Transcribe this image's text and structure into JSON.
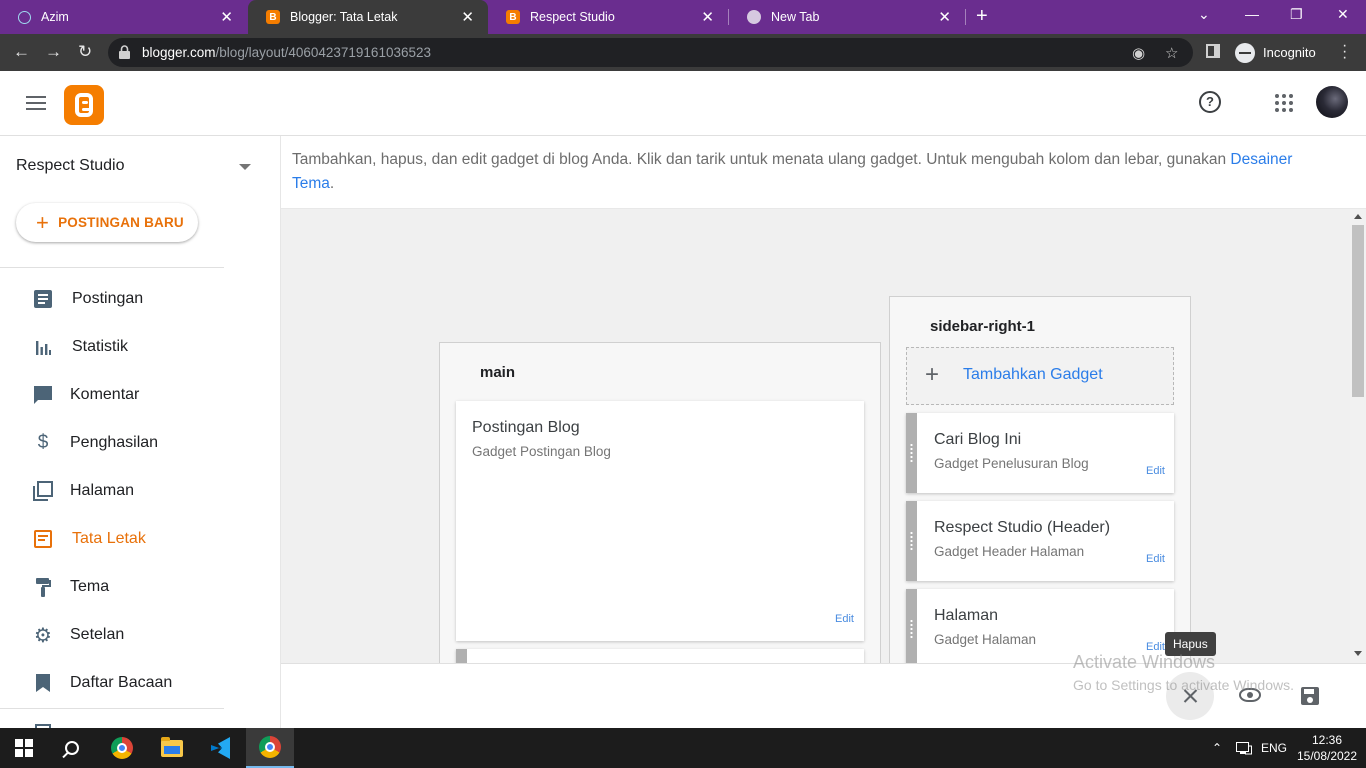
{
  "browser": {
    "tabs": [
      {
        "title": "Azim",
        "active": false
      },
      {
        "title": "Blogger: Tata Letak",
        "active": true
      },
      {
        "title": "Respect Studio",
        "active": false
      },
      {
        "title": "New Tab",
        "active": false
      }
    ],
    "close_glyph": "✕",
    "new_tab_glyph": "+",
    "url_host": "blogger.com",
    "url_path": "/blog/layout/4060423719161036523",
    "profile_label": "Incognito"
  },
  "header": {
    "help_glyph": "?"
  },
  "sidebar": {
    "blog_name": "Respect Studio",
    "new_post_plus": "+",
    "new_post_label": "POSTINGAN BARU",
    "items": [
      {
        "label": "Postingan",
        "icon": "posts-icon"
      },
      {
        "label": "Statistik",
        "icon": "stats-icon"
      },
      {
        "label": "Komentar",
        "icon": "comments-icon"
      },
      {
        "label": "Penghasilan",
        "icon": "earnings-icon"
      },
      {
        "label": "Halaman",
        "icon": "pages-icon"
      },
      {
        "label": "Tata Letak",
        "icon": "layout-icon",
        "active": true
      },
      {
        "label": "Tema",
        "icon": "theme-icon"
      },
      {
        "label": "Setelan",
        "icon": "settings-icon"
      },
      {
        "label": "Daftar Bacaan",
        "icon": "reading-list-icon"
      }
    ],
    "dollar_glyph": "$"
  },
  "main": {
    "info_text": "Tambahkan, hapus, dan edit gadget di blog Anda. Klik dan tarik untuk menata ulang gadget. Untuk mengubah kolom dan lebar, gunakan ",
    "info_link": "Desainer Tema",
    "info_end": ".",
    "sections": {
      "main": {
        "title": "main",
        "gadgets": [
          {
            "title": "Postingan Blog",
            "subtitle": "Gadget Postingan Blog",
            "edit": "Edit"
          }
        ]
      },
      "sidebar_right": {
        "title": "sidebar-right-1",
        "add_plus": "+",
        "add_label": "Tambahkan Gadget",
        "gadgets": [
          {
            "title": "Cari Blog Ini",
            "subtitle": "Gadget Penelusuran Blog",
            "edit": "Edit"
          },
          {
            "title": "Respect Studio (Header)",
            "subtitle": "Gadget Header Halaman",
            "edit": "Edit"
          },
          {
            "title": "Halaman",
            "subtitle": "Gadget Halaman",
            "edit": "Edit"
          }
        ]
      }
    }
  },
  "actions": {
    "tooltip": "Hapus"
  },
  "watermark": {
    "line1": "Activate Windows",
    "line2": "Go to Settings to activate Windows."
  },
  "taskbar": {
    "language": "ENG",
    "time": "12:36",
    "date": "15/08/2022"
  },
  "colors": {
    "accent": "#e8710a",
    "link": "#2b7de9",
    "tabbar": "#6a2d8f"
  }
}
